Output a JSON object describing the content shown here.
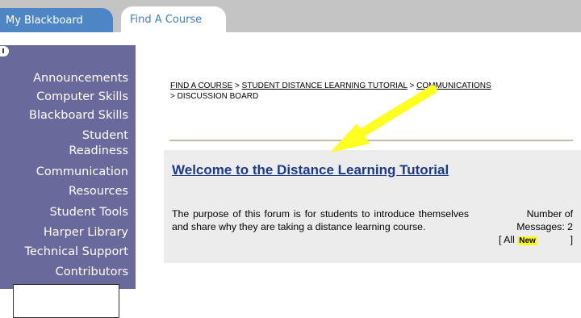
{
  "tabs": [
    {
      "label": "My Blackboard"
    },
    {
      "label": "Find A Course"
    }
  ],
  "sidebar": {
    "items": [
      {
        "label": "Announcements"
      },
      {
        "label": "Computer Skills"
      },
      {
        "label": "Blackboard Skills"
      },
      {
        "label": "Student Readiness",
        "line1": "Student",
        "line2": "Readiness"
      },
      {
        "label": "Communication"
      },
      {
        "label": "Resources"
      },
      {
        "label": "Student Tools"
      },
      {
        "label": "Harper Library"
      },
      {
        "label": "Technical Support"
      },
      {
        "label": "Contributors"
      }
    ]
  },
  "breadcrumb": {
    "items": [
      "FIND A COURSE",
      "STUDENT DISTANCE LEARNING TUTORIAL",
      "COMMUNICATIONS",
      "DISCUSSION BOARD"
    ],
    "separator": ">"
  },
  "forum": {
    "title": "Welcome to the Distance Learning Tutorial",
    "description": "The purpose of this forum is for students to introduce themselves and share why they are taking a distance learning course.",
    "count_label_1": "Number of",
    "count_label_2": "Messages: 2",
    "all_label": "All",
    "new_label": "New"
  },
  "colors": {
    "tab_active": "#4e86c5",
    "sidebar": "#6a699b",
    "arrow": "#ffff22",
    "title": "#1c3a8a"
  }
}
